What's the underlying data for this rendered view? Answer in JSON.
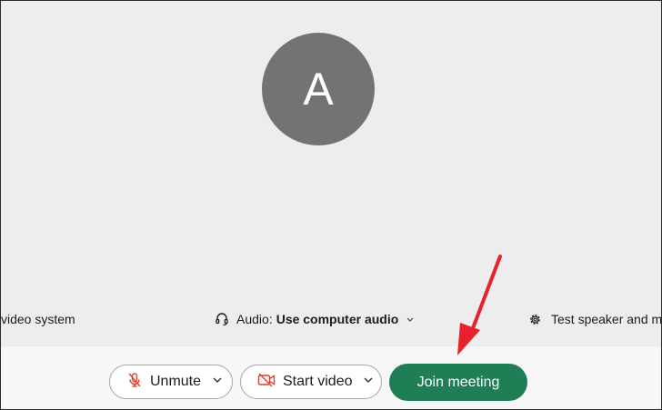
{
  "avatar": {
    "initial": "A"
  },
  "options": {
    "video_system_label": "video system",
    "audio_prefix": "Audio:",
    "audio_value": "Use computer audio",
    "test_label": "Test speaker and m"
  },
  "controls": {
    "unmute_label": "Unmute",
    "start_video_label": "Start video",
    "join_label": "Join meeting"
  },
  "icons": {
    "mic_muted": "microphone-muted-icon",
    "video_off": "video-off-icon",
    "headset": "headset-icon",
    "gear": "gear-icon",
    "chevron": "chevron-down-icon",
    "arrow": "red-arrow-annotation"
  },
  "colors": {
    "join_bg": "#1f7e55",
    "muted_red": "#d9412e",
    "avatar_bg": "#737373",
    "annotation_red": "#e8222b"
  }
}
